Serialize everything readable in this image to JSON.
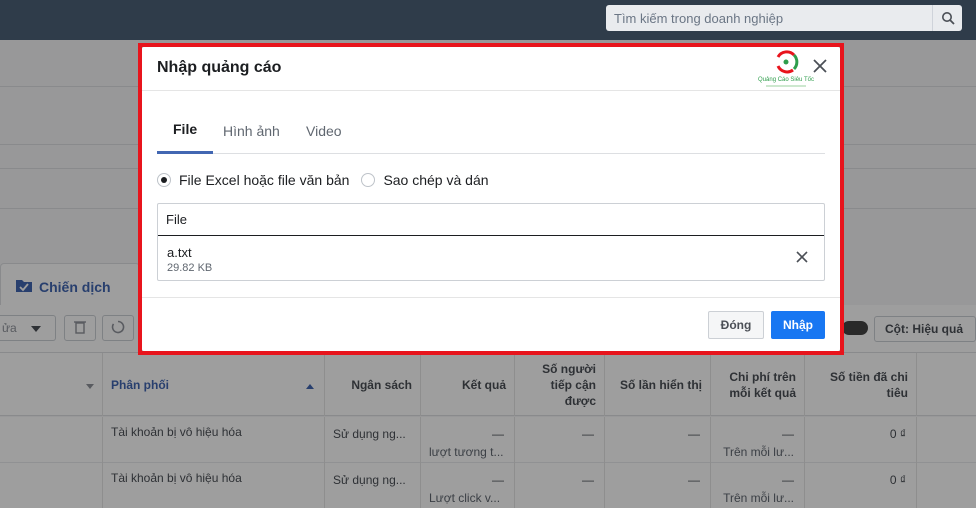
{
  "topbar": {
    "search_placeholder": "Tìm kiếm trong doanh nghiệp"
  },
  "background": {
    "campaign_tab": "Chiến dịch",
    "edit_label": "ửa",
    "columns_button": "Cột: Hiệu quả",
    "table": {
      "headers": [
        "Phân phối",
        "Ngân sách",
        "Kết quả",
        "Số người tiếp cận được",
        "Số lần hiển thị",
        "Chi phí trên mỗi kết quả",
        "Số tiền đã chi tiêu"
      ],
      "rows": [
        {
          "delivery": "Tài khoản bị vô hiệu hóa",
          "budget": "Sử dụng ng...",
          "result": "—",
          "result_sub": "lượt tương t...",
          "reach": "—",
          "impressions": "—",
          "cost": "—",
          "cost_sub": "Trên mỗi lư...",
          "spent": "0 ₫"
        },
        {
          "delivery": "Tài khoản bị vô hiệu hóa",
          "budget": "Sử dụng ng...",
          "result": "—",
          "result_sub": "Lượt click v...",
          "reach": "—",
          "impressions": "—",
          "cost": "—",
          "cost_sub": "Trên mỗi lư...",
          "spent": "0 ₫"
        }
      ]
    }
  },
  "dialog": {
    "title": "Nhập quảng cáo",
    "logo_text": "Quảng Cáo Siêu Tốc",
    "tabs": [
      {
        "label": "File",
        "active": true
      },
      {
        "label": "Hình ảnh",
        "active": false
      },
      {
        "label": "Video",
        "active": false
      }
    ],
    "radio_options": [
      {
        "label": "File Excel hoặc file văn bản",
        "selected": true
      },
      {
        "label": "Sao chép và dán",
        "selected": false
      }
    ],
    "file_section": {
      "header": "File",
      "file_name": "a.txt",
      "file_size": "29.82 KB"
    },
    "buttons": {
      "close": "Đóng",
      "import": "Nhập"
    }
  },
  "colors": {
    "accent": "#1877f2",
    "highlight_frame": "#e8141c",
    "tab_underline": "#4267b2"
  }
}
